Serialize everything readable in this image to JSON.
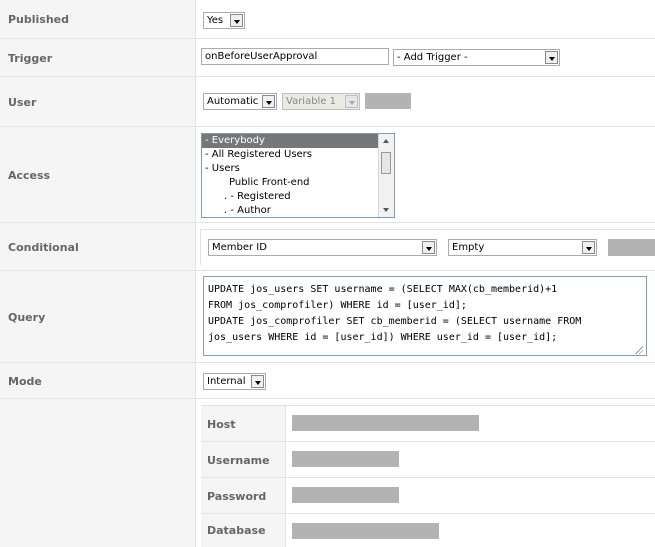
{
  "published": {
    "label": "Published",
    "value": "Yes"
  },
  "trigger": {
    "label": "Trigger",
    "value": "onBeforeUserApproval",
    "add_trigger": "- Add Trigger -"
  },
  "user": {
    "label": "User",
    "mode": "Automatic",
    "variable": "Variable 1"
  },
  "access": {
    "label": "Access",
    "options": [
      "- Everybody",
      "- All Registered Users",
      "- Users",
      "Public Front-end",
      ". - Registered",
      ". - Author"
    ]
  },
  "conditional": {
    "label": "Conditional",
    "field": "Member ID",
    "operator": "Empty"
  },
  "query": {
    "label": "Query",
    "value": "UPDATE jos_users SET username = (SELECT MAX(cb_memberid)+1\nFROM jos_comprofiler) WHERE id = [user_id];\nUPDATE jos_comprofiler SET cb_memberid = (SELECT username FROM\njos_users WHERE id = [user_id]) WHERE user_id = [user_id];"
  },
  "mode": {
    "label": "Mode",
    "value": "Internal"
  },
  "connection": {
    "host": "Host",
    "username": "Username",
    "password": "Password",
    "database": "Database"
  }
}
